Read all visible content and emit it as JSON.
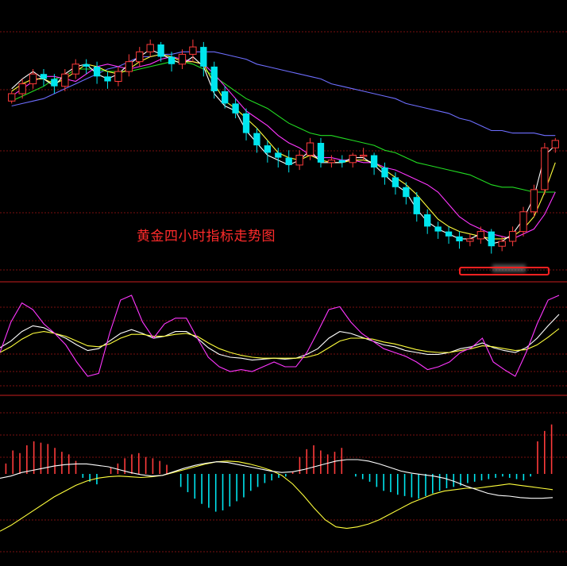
{
  "title": "黄金四小时指标走势图",
  "colors": {
    "background": "#000000",
    "up": "#ff3b3b",
    "down": "#00e5ee",
    "divider": "#c81e1e",
    "grid": "#7a1010",
    "ma5": "#ffffff",
    "ma10": "#ffff3c",
    "ma20": "#ff36ff",
    "ma40": "#22dd22",
    "ma60": "#6e6eff",
    "kdj_k": "#ffffff",
    "kdj_d": "#ffff3c",
    "kdj_j": "#ff36ff",
    "dif": "#ffffff",
    "dea": "#ffff3c"
  },
  "chart_data": [
    {
      "panel": "price",
      "type": "candlestick",
      "series": [
        {
          "name": "",
          "values": [
            90,
            91,
            92,
            93,
            95,
            97,
            99,
            101,
            103,
            105,
            106,
            108,
            110,
            110,
            111,
            111,
            112,
            112,
            112,
            112,
            111,
            110,
            109,
            107,
            106,
            105,
            104,
            103,
            102,
            101,
            99,
            98,
            97,
            96,
            95,
            94,
            93,
            91,
            90,
            89,
            88,
            87,
            85,
            84,
            82,
            80,
            80,
            79,
            79,
            79,
            78,
            78
          ]
        },
        {
          "name": "",
          "values": [
            92,
            94,
            96,
            98,
            101,
            102,
            105,
            105,
            105,
            104,
            104,
            104,
            105,
            106,
            107,
            108,
            108,
            107,
            105,
            102,
            99,
            96,
            93,
            91,
            89,
            86,
            83,
            81,
            79,
            78,
            78,
            77,
            76,
            75,
            74,
            72,
            71,
            69,
            67,
            66,
            65,
            64,
            63,
            62,
            60,
            58,
            57,
            57,
            56,
            55,
            55,
            55
          ]
        },
        {
          "name": "",
          "values": [
            94,
            97,
            100,
            102,
            102,
            101,
            100,
            103,
            106,
            107,
            106,
            105,
            106,
            107,
            109,
            110,
            109,
            108,
            107,
            103,
            98,
            93,
            88,
            85,
            82,
            78,
            75,
            73,
            70,
            69,
            69,
            68,
            68,
            67,
            67,
            65,
            64,
            62,
            60,
            58,
            55,
            50,
            45,
            42,
            40,
            38,
            37,
            36,
            38,
            40,
            46,
            55
          ]
        },
        {
          "name": "",
          "values": [
            96,
            99,
            101,
            101,
            99,
            101,
            104,
            107,
            106,
            104,
            103,
            105,
            108,
            110,
            111,
            110,
            108,
            108,
            107,
            99,
            92,
            89,
            85,
            81,
            76,
            71,
            69,
            68,
            70,
            68,
            67,
            67,
            68,
            68,
            67,
            64,
            61,
            58,
            54,
            49,
            44,
            41,
            39,
            38,
            37,
            36,
            36,
            37,
            40,
            45,
            55,
            67
          ]
        },
        {
          "name": "",
          "values": [
            97,
            101,
            104,
            101,
            98,
            103,
            106,
            107,
            103,
            101,
            103,
            107,
            110,
            113,
            111,
            109,
            107,
            110,
            106,
            95,
            90,
            88,
            80,
            75,
            70,
            68,
            66,
            68,
            72,
            67,
            67,
            67,
            69,
            69,
            66,
            62,
            58,
            55,
            48,
            43,
            40,
            38,
            36,
            36,
            38,
            34,
            35,
            38,
            44,
            53,
            70,
            74
          ]
        }
      ],
      "candles": [
        [
          92,
          95,
          91,
          96
        ],
        [
          95,
          99,
          93,
          101
        ],
        [
          99,
          103,
          97,
          105
        ],
        [
          103,
          101,
          98,
          105
        ],
        [
          101,
          98,
          95,
          103
        ],
        [
          98,
          103,
          96,
          105
        ],
        [
          103,
          107,
          101,
          109
        ],
        [
          107,
          106,
          103,
          109
        ],
        [
          106,
          102,
          99,
          108
        ],
        [
          102,
          100,
          97,
          104
        ],
        [
          100,
          104,
          98,
          106
        ],
        [
          104,
          108,
          102,
          111
        ],
        [
          108,
          112,
          106,
          114
        ],
        [
          112,
          115,
          110,
          117
        ],
        [
          115,
          110,
          108,
          116
        ],
        [
          110,
          107,
          104,
          112
        ],
        [
          107,
          111,
          105,
          113
        ],
        [
          111,
          114,
          108,
          117
        ],
        [
          114,
          106,
          102,
          116
        ],
        [
          106,
          96,
          93,
          108
        ],
        [
          96,
          91,
          89,
          98
        ],
        [
          91,
          87,
          85,
          93
        ],
        [
          87,
          79,
          76,
          89
        ],
        [
          79,
          74,
          71,
          81
        ],
        [
          74,
          71,
          67,
          76
        ],
        [
          71,
          69,
          65,
          73
        ],
        [
          69,
          66,
          63,
          72
        ],
        [
          66,
          70,
          64,
          72
        ],
        [
          70,
          75,
          68,
          77
        ],
        [
          75,
          67,
          65,
          77
        ],
        [
          67,
          68,
          65,
          70
        ],
        [
          68,
          67,
          65,
          70
        ],
        [
          67,
          70,
          65,
          71
        ],
        [
          70,
          70,
          68,
          73
        ],
        [
          70,
          65,
          62,
          71
        ],
        [
          65,
          61,
          58,
          67
        ],
        [
          61,
          57,
          54,
          63
        ],
        [
          57,
          53,
          50,
          59
        ],
        [
          53,
          46,
          43,
          55
        ],
        [
          46,
          41,
          38,
          48
        ],
        [
          41,
          39,
          36,
          43
        ],
        [
          39,
          37,
          34,
          41
        ],
        [
          37,
          35,
          32,
          39
        ],
        [
          35,
          36,
          33,
          38
        ],
        [
          36,
          39,
          34,
          41
        ],
        [
          39,
          33,
          30,
          40
        ],
        [
          33,
          35,
          31,
          37
        ],
        [
          35,
          39,
          33,
          41
        ],
        [
          39,
          47,
          37,
          49
        ],
        [
          47,
          56,
          45,
          58
        ],
        [
          56,
          73,
          54,
          75
        ],
        [
          73,
          76,
          71,
          77
        ]
      ],
      "ylim": [
        25,
        125
      ]
    },
    {
      "panel": "kdj",
      "type": "line",
      "series": [
        {
          "name": "",
          "values": [
            45,
            52,
            62,
            68,
            66,
            60,
            55,
            48,
            42,
            44,
            52,
            60,
            64,
            60,
            55,
            57,
            62,
            62,
            55,
            45,
            38,
            35,
            34,
            32,
            33,
            34,
            33,
            34,
            38,
            44,
            55,
            62,
            60,
            56,
            52,
            48,
            46,
            42,
            40,
            38,
            38,
            40,
            44,
            46,
            50,
            45,
            42,
            40,
            45,
            55,
            68,
            80
          ]
        },
        {
          "name": "",
          "values": [
            40,
            46,
            54,
            60,
            62,
            60,
            57,
            52,
            47,
            46,
            49,
            55,
            59,
            59,
            57,
            57,
            59,
            60,
            57,
            50,
            44,
            40,
            37,
            35,
            34,
            34,
            34,
            34,
            35,
            38,
            45,
            52,
            55,
            55,
            54,
            51,
            49,
            46,
            43,
            41,
            40,
            40,
            42,
            44,
            47,
            46,
            44,
            42,
            43,
            48,
            56,
            65
          ]
        },
        {
          "name": "",
          "values": [
            40,
            72,
            92,
            85,
            70,
            60,
            48,
            30,
            15,
            18,
            60,
            95,
            100,
            72,
            55,
            70,
            76,
            76,
            55,
            35,
            25,
            20,
            22,
            20,
            25,
            30,
            25,
            25,
            40,
            62,
            85,
            88,
            72,
            60,
            52,
            44,
            40,
            36,
            30,
            22,
            25,
            30,
            40,
            45,
            55,
            30,
            22,
            15,
            40,
            70,
            95,
            100
          ]
        }
      ],
      "ylim": [
        0,
        100
      ]
    },
    {
      "panel": "macd",
      "type": "bar",
      "series": [
        {
          "name": "",
          "values": [
            -6,
            -3,
            2,
            5,
            8,
            11,
            13,
            14,
            14,
            12,
            10,
            6,
            2,
            -1,
            -3,
            -2,
            3,
            8,
            12,
            15,
            17,
            16,
            13,
            10,
            7,
            4,
            2,
            3,
            6,
            10,
            14,
            18,
            20,
            20,
            18,
            14,
            9,
            4,
            1,
            -1,
            -3,
            -6,
            -11,
            -17,
            -22,
            -27,
            -30,
            -31,
            -33,
            -34,
            -34,
            -33
          ]
        },
        {
          "name": "",
          "values": [
            -80,
            -72,
            -62,
            -52,
            -42,
            -32,
            -24,
            -16,
            -10,
            -6,
            -4,
            -3,
            -4,
            -5,
            -4,
            -2,
            2,
            6,
            10,
            14,
            17,
            18,
            17,
            14,
            10,
            5,
            -2,
            -14,
            -30,
            -48,
            -64,
            -74,
            -76,
            -74,
            -70,
            -64,
            -56,
            -48,
            -40,
            -34,
            -28,
            -24,
            -22,
            -20,
            -20,
            -18,
            -16,
            -14,
            -16,
            -18,
            -20,
            -22
          ]
        },
        {
          "name": "",
          "values": [
            16,
            36,
            32,
            44,
            50,
            48,
            46,
            40,
            34,
            30,
            20,
            -6,
            -12,
            -16,
            0,
            10,
            16,
            24,
            30,
            32,
            26,
            24,
            20,
            14,
            0,
            -20,
            -28,
            -38,
            -46,
            -52,
            -58,
            -56,
            -50,
            -42,
            -36,
            -26,
            -20,
            -14,
            -10,
            -6,
            -4,
            4,
            26,
            38,
            44,
            36,
            30,
            34,
            40,
            0,
            -4,
            -8,
            -12,
            -20,
            -26,
            -28,
            -32,
            -34,
            -36,
            -38,
            -34,
            -30,
            -26,
            -22,
            -20,
            -18,
            -14,
            -12,
            -10,
            -8,
            -6,
            -4,
            -6,
            -8,
            -10,
            -4,
            50,
            66,
            76
          ]
        }
      ],
      "ylim": [
        -100,
        100
      ]
    }
  ]
}
